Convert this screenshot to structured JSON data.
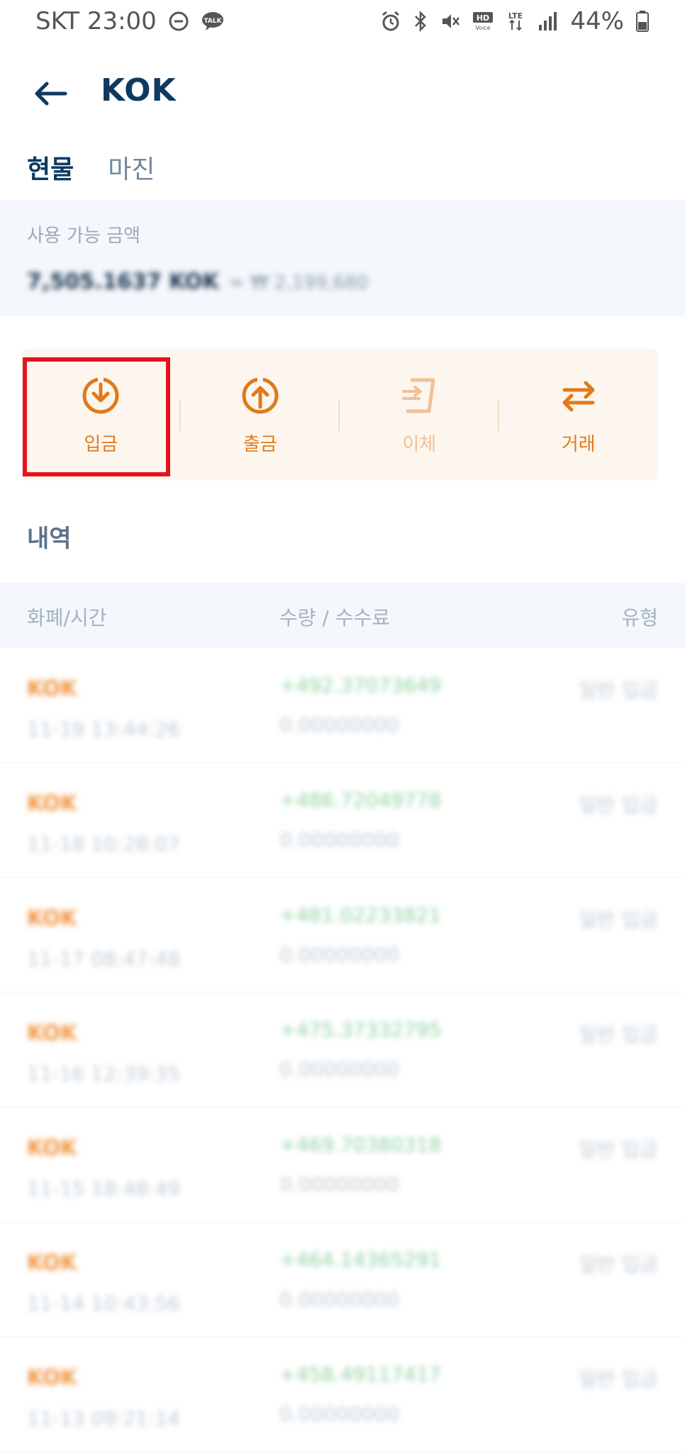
{
  "status_bar": {
    "carrier_time": "SKT 23:00",
    "battery": "44%",
    "lte_label": "LTE",
    "hd_label": "HD",
    "voice_label": "Voice",
    "talk_label": "TALK"
  },
  "header": {
    "title": "KOK"
  },
  "tabs": [
    {
      "label": "현물",
      "active": true
    },
    {
      "label": "마진",
      "active": false
    }
  ],
  "balance": {
    "label": "사용 가능 금액",
    "amount": "7,505.1637 KOK",
    "krw": "≈ ₩ 2,199,680"
  },
  "actions": [
    {
      "label": "입금",
      "icon": "deposit-icon",
      "enabled": true
    },
    {
      "label": "출금",
      "icon": "withdraw-icon",
      "enabled": true
    },
    {
      "label": "이체",
      "icon": "transfer-icon",
      "enabled": false
    },
    {
      "label": "거래",
      "icon": "trade-icon",
      "enabled": true
    }
  ],
  "history": {
    "title": "내역",
    "columns": [
      "화폐/시간",
      "수량 / 수수료",
      "유형"
    ],
    "rows": [
      {
        "currency": "KOK",
        "time": "11-19 13:44:26",
        "amount": "+492.37073649",
        "fee": "0.00000000",
        "type": "일반 입금"
      },
      {
        "currency": "KOK",
        "time": "11-18 10:28:07",
        "amount": "+486.72049778",
        "fee": "0.00000000",
        "type": "일반 입금"
      },
      {
        "currency": "KOK",
        "time": "11-17 08:47:48",
        "amount": "+481.02233821",
        "fee": "0.00000000",
        "type": "일반 입금"
      },
      {
        "currency": "KOK",
        "time": "11-16 12:39:35",
        "amount": "+475.37332795",
        "fee": "0.00000000",
        "type": "일반 입금"
      },
      {
        "currency": "KOK",
        "time": "11-15 18:48:49",
        "amount": "+469.70380318",
        "fee": "0.00000000",
        "type": "일반 입금"
      },
      {
        "currency": "KOK",
        "time": "11-14 10:43:56",
        "amount": "+464.14365291",
        "fee": "0.00000000",
        "type": "일반 입금"
      },
      {
        "currency": "KOK",
        "time": "11-13 09:21:14",
        "amount": "+458.49117417",
        "fee": "0.00000000",
        "type": "일반 입금"
      }
    ]
  },
  "colors": {
    "primary": "#0f3a5f",
    "accent": "#e07a1a",
    "highlight": "#e3141f",
    "positive": "#8fd2a3"
  }
}
